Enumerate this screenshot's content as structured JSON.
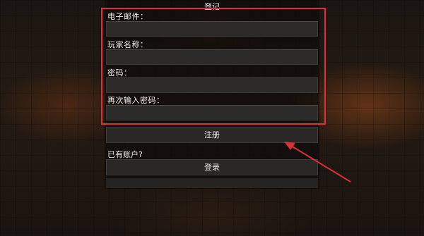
{
  "window": {
    "title": "登记"
  },
  "form": {
    "fields": [
      {
        "label": "电子邮件：",
        "value": ""
      },
      {
        "label": "玩家名称：",
        "value": ""
      },
      {
        "label": "密码：",
        "value": ""
      },
      {
        "label": "再次输入密码：",
        "value": ""
      }
    ],
    "register_label": "注册",
    "have_account_text": "已有账户?",
    "login_label": "登录"
  },
  "annotation": {
    "highlight_color": "#d9303a"
  }
}
